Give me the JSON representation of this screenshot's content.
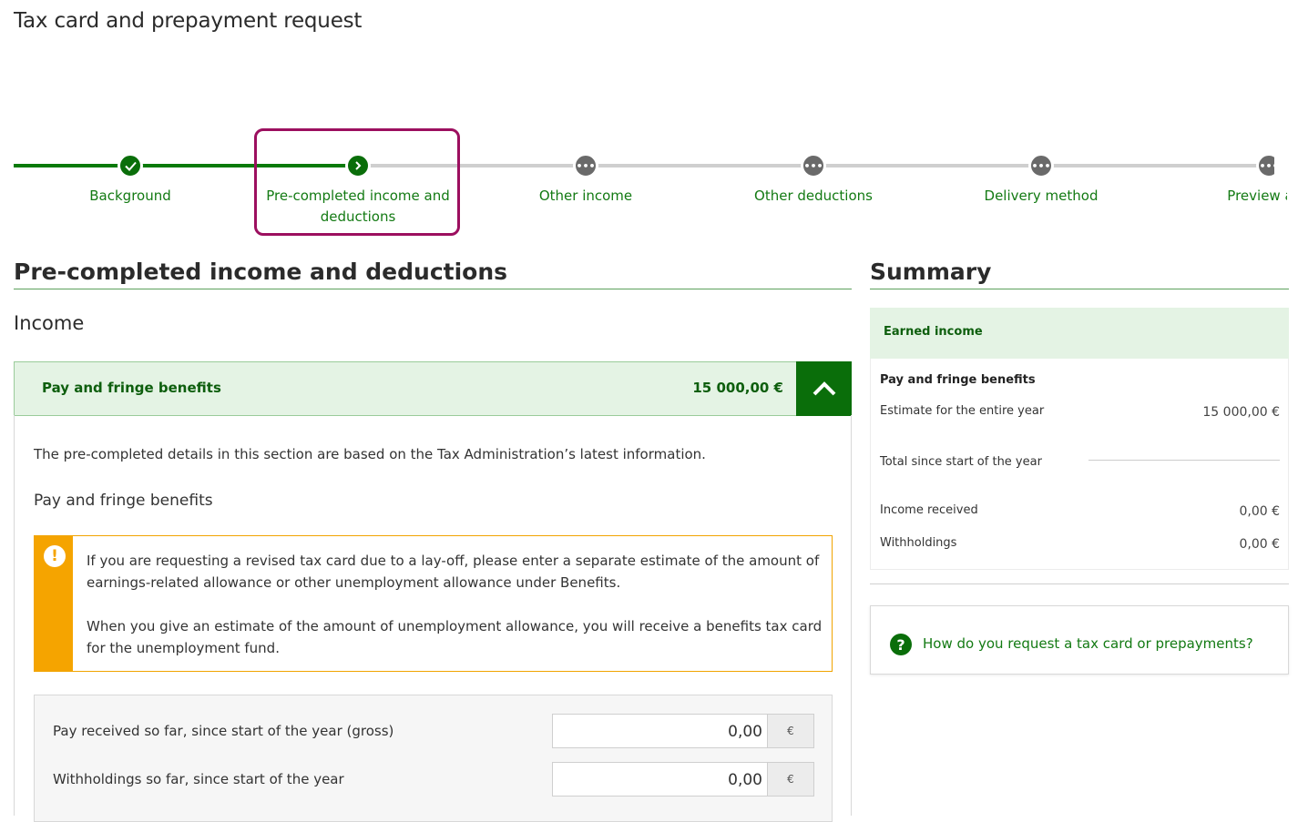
{
  "page": {
    "title": "Tax card and prepayment request"
  },
  "stepper": {
    "steps": [
      {
        "label": "Background",
        "state": "done"
      },
      {
        "label": "Pre-completed income and deductions",
        "state": "current"
      },
      {
        "label": "Other income",
        "state": "todo"
      },
      {
        "label": "Other deductions",
        "state": "todo"
      },
      {
        "label": "Delivery method",
        "state": "todo"
      },
      {
        "label": "Preview and",
        "state": "todo"
      }
    ]
  },
  "main": {
    "title": "Pre-completed income and deductions",
    "income_heading": "Income",
    "accordion": {
      "title": "Pay and fringe benefits",
      "amount": "15 000,00 €",
      "info": "The pre-completed details in this section are based on the Tax Administration’s latest information.",
      "subheading": "Pay and fringe benefits",
      "notice": {
        "para1": "If you are requesting a revised tax card due to a lay-off, please enter a separate estimate of the amount of earnings-related allowance or other unemployment allowance under Benefits.",
        "para2": "When you give an estimate of the amount of unemployment allowance, you will receive a benefits tax card for the unemployment fund."
      },
      "fields": [
        {
          "label": "Pay received so far, since start of the year (gross)",
          "value": "0,00",
          "unit": "€"
        },
        {
          "label": "Withholdings so far, since start of the year",
          "value": "0,00",
          "unit": "€"
        }
      ]
    }
  },
  "summary": {
    "title": "Summary",
    "section_title": "Earned income",
    "item_title": "Pay and fringe benefits",
    "rows": [
      {
        "label": "Estimate for the entire year",
        "value": "15 000,00 €"
      },
      {
        "label": "Total since start of the year",
        "value": ""
      },
      {
        "label": "Income received",
        "value": "0,00 €"
      },
      {
        "label": "Withholdings",
        "value": "0,00 €"
      }
    ],
    "help_link": "How do you request a tax card or prepayments?"
  },
  "colors": {
    "brand_green": "#0a6e0a",
    "current_highlight": "#9c0f5f",
    "warning": "#f5a400"
  }
}
